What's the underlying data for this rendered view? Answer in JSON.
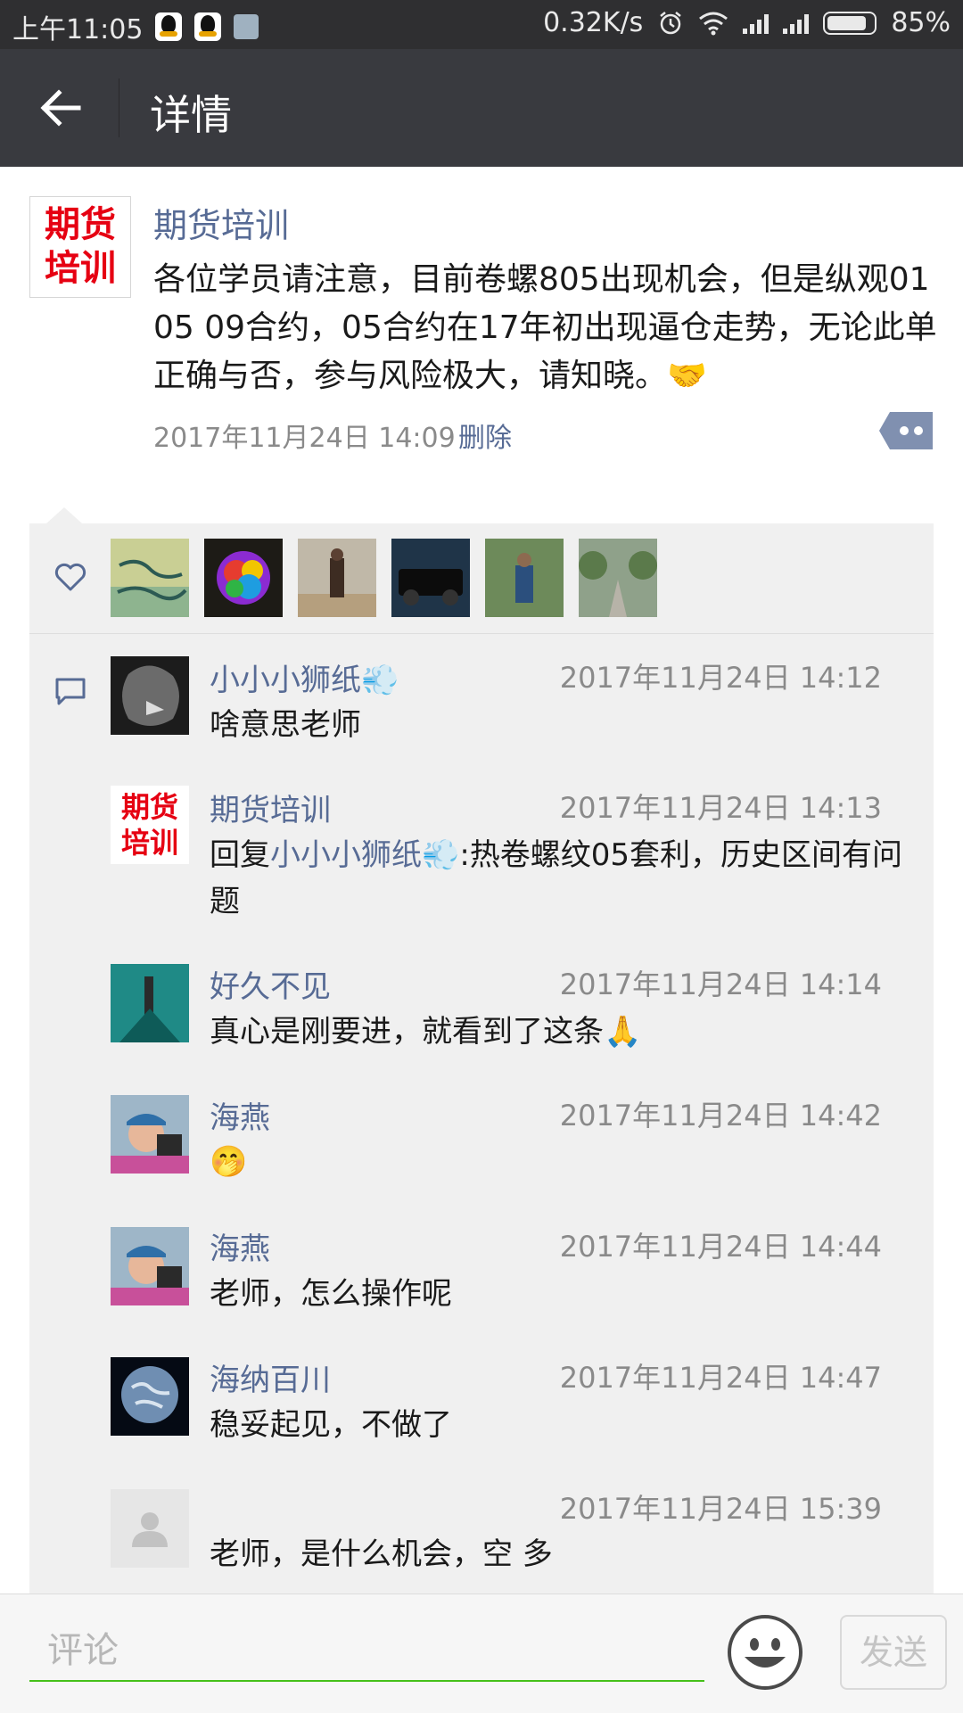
{
  "status_bar": {
    "time": "上午11:05",
    "speed": "0.32K/s",
    "battery": "85%",
    "battery_level": 0.85,
    "icons": [
      "qq-icon",
      "qq-icon",
      "message-icon",
      "alarm-icon",
      "wifi-icon",
      "signal-icon",
      "signal-icon",
      "battery-icon"
    ]
  },
  "header": {
    "title": "详情",
    "back_icon": "arrow-left-icon"
  },
  "post": {
    "author": "期货培训",
    "avatar_text": [
      "期货",
      "培训"
    ],
    "text": "各位学员请注意，目前卷螺805出现机会，但是纵观01 05 09合约，05合约在17年初出现逼仓走势，无论此单正确与否，参与风险极大，请知晓。",
    "text_emoji": "🤝",
    "time": "2017年11月24日 14:09",
    "delete_label": "删除",
    "more_icon": "more-dots-icon"
  },
  "likes": {
    "icon": "heart-icon",
    "avatars": [
      "avatar-1",
      "avatar-2",
      "avatar-3",
      "avatar-4",
      "avatar-5",
      "avatar-6"
    ]
  },
  "comments": [
    {
      "name": "小小小狮纸",
      "name_emoji": "💨",
      "time": "2017年11月24日 14:12",
      "text": "啥意思老师"
    },
    {
      "name": "期货培训",
      "time": "2017年11月24日 14:13",
      "reply_prefix": "回复",
      "reply_to": "小小小狮纸",
      "reply_emoji": "💨",
      "text": ":热卷螺纹05套利，历史区间有问题"
    },
    {
      "name": "好久不见",
      "time": "2017年11月24日 14:14",
      "text": "真心是刚要进，就看到了这条",
      "text_emoji": "🙏"
    },
    {
      "name": "海燕",
      "time": "2017年11月24日 14:42",
      "text": "🤭"
    },
    {
      "name": "海燕",
      "time": "2017年11月24日 14:44",
      "text": "老师，怎么操作呢"
    },
    {
      "name": "海纳百川",
      "time": "2017年11月24日 14:47",
      "text": "稳妥起见，不做了"
    },
    {
      "name": "",
      "time": "2017年11月24日 15:39",
      "text": "老师，是什么机会，空  多"
    }
  ],
  "input": {
    "placeholder": "评论",
    "send_label": "发送",
    "emoji_icon": "smiley-icon"
  }
}
